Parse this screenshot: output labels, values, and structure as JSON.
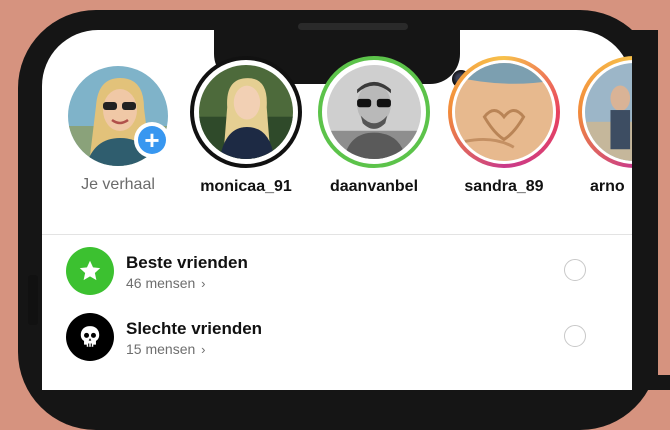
{
  "stories": [
    {
      "name": "Je verhaal",
      "own": true
    },
    {
      "name": "monicaa_91"
    },
    {
      "name": "daanvanbel"
    },
    {
      "name": "sandra_89"
    },
    {
      "name": "arno"
    }
  ],
  "list": [
    {
      "title": "Beste vrienden",
      "subtitle": "46 mensen",
      "icon": "star-icon",
      "color": "#3cc130"
    },
    {
      "title": "Slechte vrienden",
      "subtitle": "15 mensen",
      "icon": "skull-icon",
      "color": "#000000"
    }
  ],
  "add_symbol": "+",
  "chevron": "›",
  "colors": {
    "background": "#d6937f",
    "phone": "#151515",
    "add_badge": "#3897f0",
    "close_friends_ring": "#5cc34a"
  }
}
